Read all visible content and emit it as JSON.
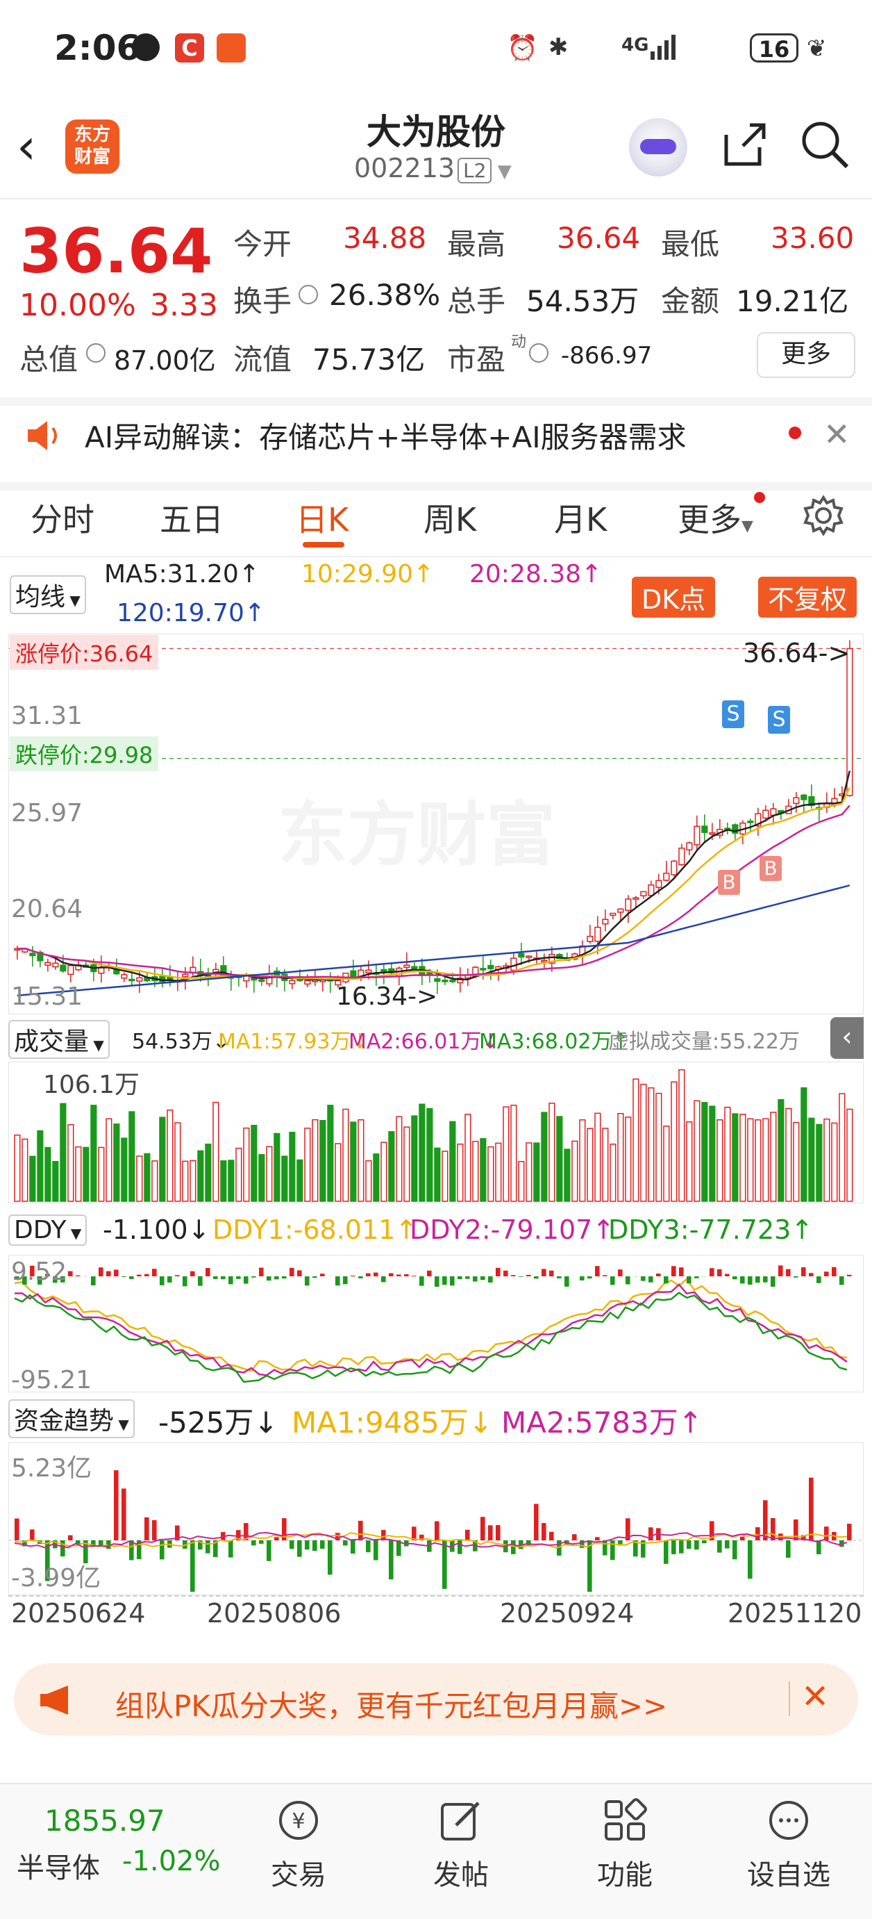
{
  "status": {
    "time": "2:06",
    "battery": "16",
    "network": "4G"
  },
  "header": {
    "logo_text_1": "东方",
    "logo_text_2": "财富",
    "title": "大为股份",
    "code": "002213",
    "level": "L2"
  },
  "quote": {
    "price": "36.64",
    "change_pct": "10.00%",
    "change": "3.33",
    "open_label": "今开",
    "open": "34.88",
    "high_label": "最高",
    "high": "36.64",
    "low_label": "最低",
    "low": "33.60",
    "turnover_label": "换手",
    "turnover": "26.38%",
    "volume_label": "总手",
    "volume": "54.53万",
    "amount_label": "金额",
    "amount": "19.21亿",
    "mktcap_label": "总值",
    "mktcap": "87.00亿",
    "float_label": "流值",
    "float": "75.73亿",
    "pe_label": "市盈",
    "pe_sup": "动",
    "pe": "-866.97",
    "more_label": "更多"
  },
  "ai_bar": {
    "text": "AI异动解读：存储芯片+半导体+AI服务器需求"
  },
  "tabs": [
    "分时",
    "五日",
    "日K",
    "周K",
    "月K",
    "更多"
  ],
  "active_tab": 2,
  "ma": {
    "selector": "均线",
    "ma5": "MA5:31.20↑",
    "ma10": "10:29.90↑",
    "ma20": "20:28.38↑",
    "ma120": "120:19.70↑",
    "dk_button": "DK点",
    "fq_button": "不复权"
  },
  "kchart": {
    "limit_up": "涨停价:36.64",
    "limit_down": "跌停价:29.98",
    "y_labels": [
      "31.31",
      "25.97",
      "20.64",
      "15.31"
    ],
    "top_price": "36.64->",
    "low_marker": "16.34->",
    "top_partial": "36.64"
  },
  "volume": {
    "selector": "成交量",
    "value": "54.53万↓",
    "ma1": "MA1:57.93万↓",
    "ma2": "MA2:66.01万↓",
    "ma3": "MA3:68.02万↑",
    "virtual": "虚拟成交量:55.22万",
    "max_label": "106.1万"
  },
  "ddy": {
    "selector": "DDY",
    "value": "-1.100↓",
    "ddy1": "DDY1:-68.011↑",
    "ddy2": "DDY2:-79.107↑",
    "ddy3": "DDY3:-77.723↑",
    "top_label": "9.52",
    "bottom_label": "-95.21"
  },
  "fund": {
    "selector": "资金趋势",
    "value": "-525万↓",
    "ma1": "MA1:9485万↓",
    "ma2": "MA2:5783万↑",
    "top_label": "5.23亿",
    "bottom_label": "-3.99亿"
  },
  "dates": [
    "20250624",
    "20250806",
    "20250924",
    "20251120"
  ],
  "banner": {
    "text": "组队PK瓜分大奖，更有千元红包月月赢>>"
  },
  "bottom_nav": {
    "index_value": "1855.97",
    "index_name": "半导体",
    "index_change": "-1.02%",
    "items": [
      "交易",
      "发帖",
      "功能",
      "设自选"
    ]
  },
  "colors": {
    "up": "#e02020",
    "down": "#1a9a1a",
    "accent": "#f05a22",
    "ma5": "#222222",
    "ma10": "#f0b400",
    "ma20": "#cc2299",
    "ma120": "#2244aa"
  }
}
